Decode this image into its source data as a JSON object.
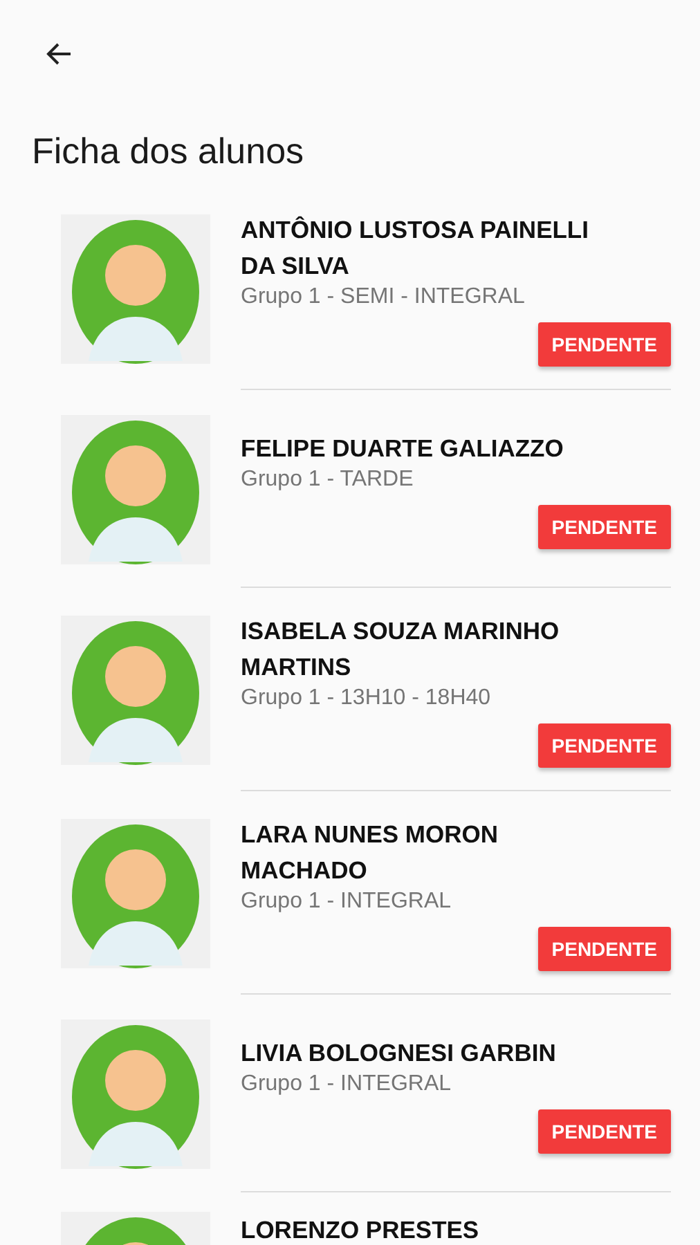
{
  "title": "Ficha dos alunos",
  "students": [
    {
      "name": "ANTÔNIO LUSTOSA PAINELLI DA SILVA",
      "group": "Grupo 1 - SEMI - INTEGRAL",
      "status": "PENDENTE"
    },
    {
      "name": "FELIPE DUARTE GALIAZZO",
      "group": "Grupo 1 - TARDE",
      "status": "PENDENTE"
    },
    {
      "name": "ISABELA SOUZA MARINHO MARTINS",
      "group": "Grupo 1 - 13H10 - 18H40",
      "status": "PENDENTE"
    },
    {
      "name": "LARA NUNES MORON MACHADO",
      "group": "Grupo 1 - INTEGRAL",
      "status": "PENDENTE"
    },
    {
      "name": "LIVIA BOLOGNESI GARBIN",
      "group": "Grupo 1 - INTEGRAL",
      "status": "PENDENTE"
    },
    {
      "name": "LORENZO PRESTES"
    }
  ]
}
